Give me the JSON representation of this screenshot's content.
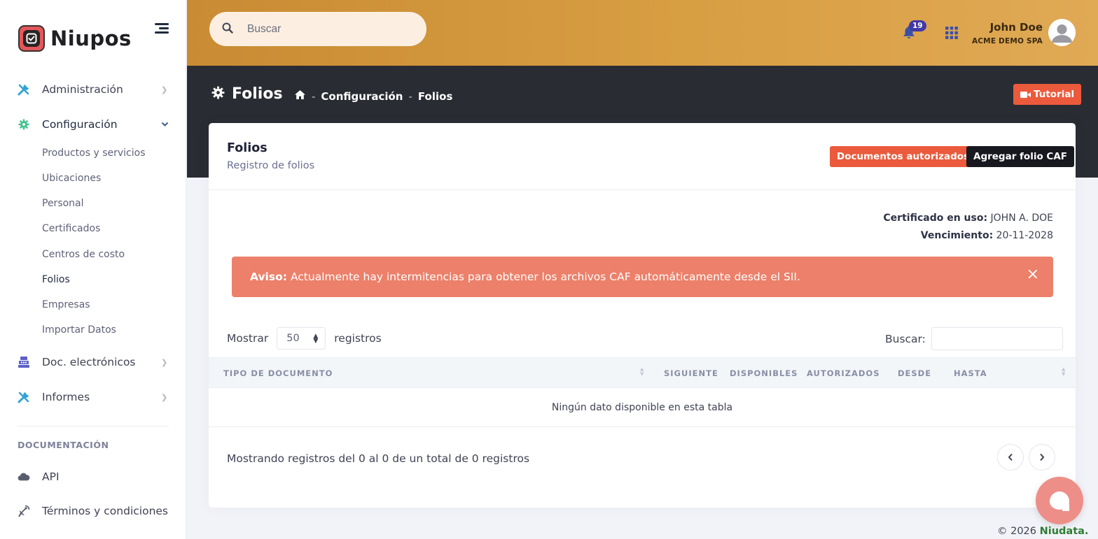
{
  "brand": {
    "name": "Niupos"
  },
  "sidebar": {
    "items": [
      {
        "label": "Administración"
      },
      {
        "label": "Configuración"
      },
      {
        "label": "Doc. electrónicos"
      },
      {
        "label": "Informes"
      }
    ],
    "sub_items": [
      {
        "label": "Productos y servicios"
      },
      {
        "label": "Ubicaciones"
      },
      {
        "label": "Personal"
      },
      {
        "label": "Certificados"
      },
      {
        "label": "Centros de costo"
      },
      {
        "label": "Folios"
      },
      {
        "label": "Empresas"
      },
      {
        "label": "Importar Datos"
      }
    ],
    "section_title": "DOCUMENTACIÓN",
    "doc_items": [
      {
        "label": "API"
      },
      {
        "label": "Términos y condiciones"
      }
    ]
  },
  "header": {
    "search_placeholder": "Buscar",
    "notifications_count": "19",
    "user_name": "John Doe",
    "user_company": "ACME DEMO SPA"
  },
  "subheader": {
    "title": "Folios",
    "breadcrumb": [
      "Configuración",
      "Folios"
    ],
    "tutorial_label": "Tutorial"
  },
  "card": {
    "title": "Folios",
    "subtitle": "Registro de folios",
    "docs_button": "Documentos autorizados",
    "add_button": "Agregar folio CAF",
    "cert_label": "Certificado en uso:",
    "cert_value": "JOHN A. DOE",
    "expiry_label": "Vencimiento:",
    "expiry_value": "20-11-2028",
    "alert_title": "Aviso:",
    "alert_text": "Actualmente hay intermitencias para obtener los archivos CAF automáticamente desde el SII.",
    "alert_close": "×",
    "length_prefix": "Mostrar",
    "length_value": "50",
    "length_suffix": "registros",
    "filter_label": "Buscar:",
    "columns": [
      "TIPO DE DOCUMENTO",
      "SIGUIENTE",
      "DISPONIBLES",
      "AUTORIZADOS",
      "DESDE",
      "HASTA"
    ],
    "empty_text": "Ningún dato disponible en esta tabla",
    "info_text": "Mostrando registros del 0 al 0 de un total de 0 registros"
  },
  "footer": {
    "copyright": "© 2026",
    "company": "Niudata."
  },
  "colors": {
    "accent": "#eb5a3c",
    "header_gold": "#d89e42",
    "subheader_dark": "#2a2c33",
    "badge": "#4338a6",
    "alert": "#ec806a"
  }
}
